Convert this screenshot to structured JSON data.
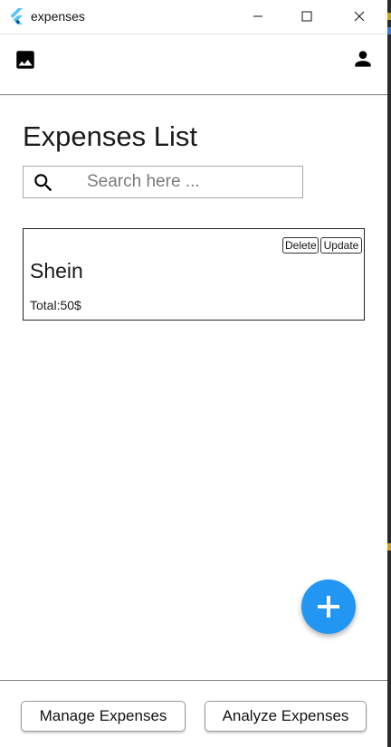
{
  "window": {
    "title": "expenses",
    "app_icon": "flutter-logo-icon"
  },
  "appbar": {
    "left_icon": "image-icon",
    "right_icon": "person-icon"
  },
  "page": {
    "title": "Expenses List"
  },
  "search": {
    "icon": "search-icon",
    "placeholder": "Search here ...",
    "value": ""
  },
  "expenses": [
    {
      "name": "Shein",
      "total_label": "Total:50$",
      "delete_label": "Delete",
      "update_label": "Update"
    }
  ],
  "fab": {
    "icon": "plus-icon"
  },
  "bottom": {
    "manage_label": "Manage Expenses",
    "analyze_label": "Analyze Expenses"
  },
  "colors": {
    "accent": "#2196f3",
    "flutter_light": "#54c5f8",
    "flutter_dark": "#01579b"
  }
}
